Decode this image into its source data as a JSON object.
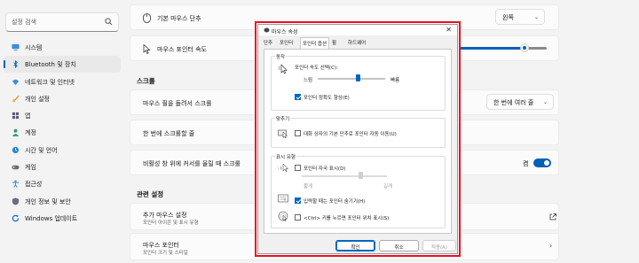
{
  "sidebar": {
    "search_placeholder": "설정 검색",
    "items": [
      {
        "label": "시스템",
        "icon": "monitor-icon"
      },
      {
        "label": "Bluetooth 및 장치",
        "icon": "bluetooth-icon",
        "selected": true
      },
      {
        "label": "네트워크 및 인터넷",
        "icon": "wifi-icon"
      },
      {
        "label": "개인 설정",
        "icon": "brush-icon"
      },
      {
        "label": "앱",
        "icon": "apps-icon"
      },
      {
        "label": "계정",
        "icon": "person-icon"
      },
      {
        "label": "시간 및 언어",
        "icon": "globe-clock-icon"
      },
      {
        "label": "게임",
        "icon": "gamepad-icon"
      },
      {
        "label": "접근성",
        "icon": "accessibility-icon"
      },
      {
        "label": "개인 정보 및 보안",
        "icon": "shield-icon"
      },
      {
        "label": "Windows 업데이트",
        "icon": "update-icon"
      }
    ]
  },
  "main": {
    "primary_button": {
      "label": "기본 마우스 단추",
      "value": "왼쪽"
    },
    "pointer_speed": {
      "label": "마우스 포인터 속도",
      "fraction": 0.75
    },
    "scroll_section": "스크롤",
    "roll_scroll": {
      "label": "마우스 휠을 돌려서 스크롤",
      "value": "한 번에 여러 줄"
    },
    "lines_once": {
      "label": "한 번에 스크롤할 줄"
    },
    "inactive_scroll": {
      "label": "비활성 창 위에 커서를 올릴 때 스크롤",
      "state": "켬"
    },
    "related_section": "관련 설정",
    "additional_mouse": {
      "label": "추가 마우스 설정",
      "sub": "포인터 아이콘 및 표시 유형"
    },
    "mouse_pointer": {
      "label": "마우스 포인터",
      "sub": "포인터 크기 및 스타일"
    }
  },
  "dialog": {
    "title": "마우스 속성",
    "tabs": [
      "단추",
      "포인터",
      "포인터 옵션",
      "휠",
      "하드웨어"
    ],
    "active_tab": "포인터 옵션",
    "motion": {
      "title": "동작",
      "speed_label": "포인터 속도 선택(C):",
      "slow": "느림",
      "fast": "빠름",
      "speed_fraction": 0.6,
      "precision": "포인터 정확도 향상(E)"
    },
    "snap": {
      "title": "맞추기",
      "label": "대화 상자의 기본 단추로 포인터 자동 이동(U)"
    },
    "visibility": {
      "title": "표시 유형",
      "trails": "포인터 자국 표시(D)",
      "short": "짧게",
      "long": "길게",
      "hide": "입력할 때는 포인터 숨기기(H)",
      "ctrl": "<Ctrl> 키를 누르면 포인터 위치 표시(S)"
    },
    "buttons": {
      "ok": "확인",
      "cancel": "취소",
      "apply": "적용(A)"
    }
  }
}
